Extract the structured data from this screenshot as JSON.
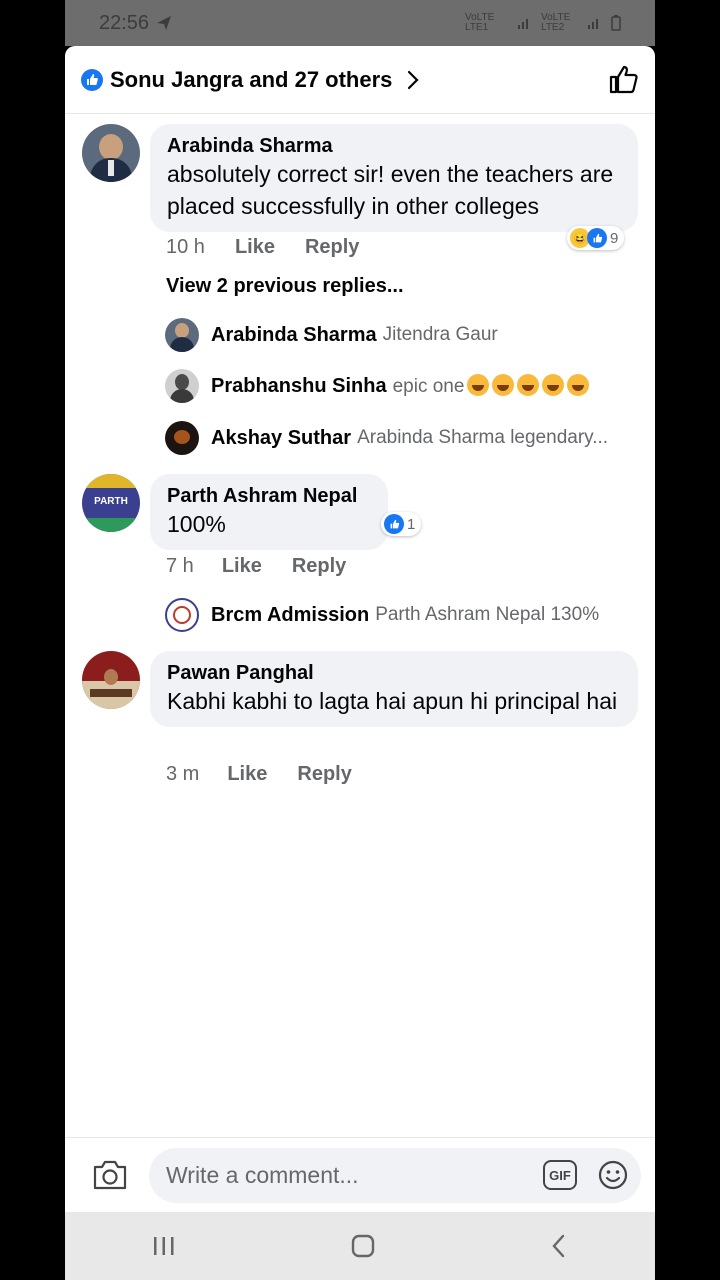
{
  "status_bar": {
    "time": "22:56",
    "sim1": "VoLTE LTE1",
    "sim2": "VoLTE LTE2"
  },
  "header": {
    "title": "Sonu Jangra and 27 others"
  },
  "comments": [
    {
      "author": "Arabinda Sharma",
      "text": "absolutely correct sir! even the teachers are placed successfully in other colleges",
      "time": "10 h",
      "like_label": "Like",
      "reply_label": "Reply",
      "reaction_count": "9",
      "view_previous": "View 2 previous replies...",
      "replies": [
        {
          "author": "Arabinda Sharma",
          "text": "Jitendra Gaur"
        },
        {
          "author": "Prabhanshu Sinha",
          "text": "epic one"
        },
        {
          "author": "Akshay Suthar",
          "text": "Arabinda Sharma legendary..."
        }
      ]
    },
    {
      "author": "Parth Ashram Nepal",
      "text": "100%",
      "time": "7 h",
      "like_label": "Like",
      "reply_label": "Reply",
      "reaction_count": "1",
      "avatar_text": "PARTH",
      "replies": [
        {
          "author": "Brcm Admission",
          "text": "Parth Ashram Nepal 130%"
        }
      ]
    },
    {
      "author": "Pawan Panghal",
      "text": "Kabhi kabhi to lagta hai apun hi principal hai",
      "time": "3 m",
      "like_label": "Like",
      "reply_label": "Reply"
    }
  ],
  "composer": {
    "placeholder": "Write a comment...",
    "gif_label": "GIF"
  },
  "colors": {
    "accent": "#1877f2",
    "bubble": "#f0f2f5",
    "secondary_text": "#65676b"
  }
}
